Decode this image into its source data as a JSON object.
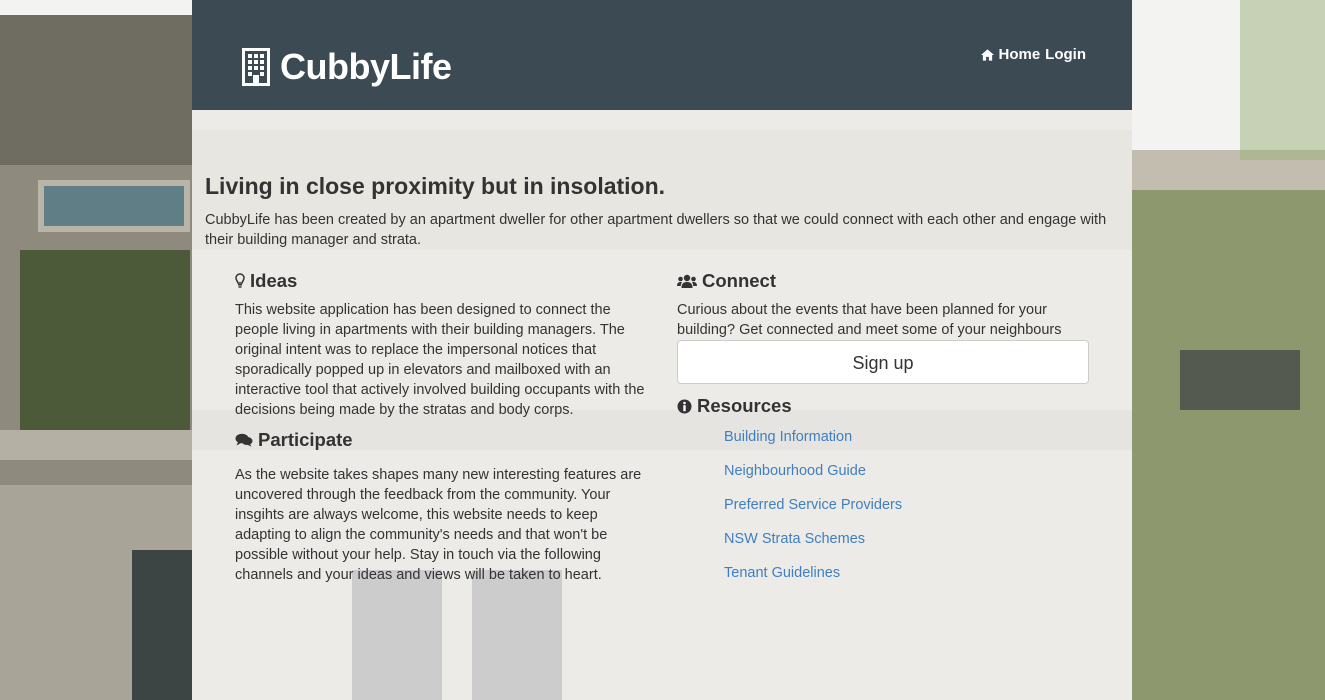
{
  "header": {
    "brand": "CubbyLife",
    "nav": {
      "home": "Home",
      "login": "Login"
    }
  },
  "main": {
    "headline": "Living in close proximity but in insolation.",
    "intro": "CubbyLife has been created by an apartment dweller for other apartment dwellers so that we could connect with each other and engage with their building manager and strata.",
    "ideas": {
      "title": "Ideas",
      "body": "This website application has been designed to connect the people living in apartments with their building managers. The original intent was to replace the impersonal notices that sporadically popped up in elevators and mailboxed with an interactive tool that actively involved building occupants with the decisions being made by the stratas and body corps."
    },
    "participate": {
      "title": "Participate",
      "body": "As the website takes shapes many new interesting features are uncovered through the feedback from the community. Your insgihts are always welcome, this website needs to keep adapting to align the community's needs and that won't be possible without your help. Stay in touch via the following channels and your ideas and views will be taken to heart."
    },
    "connect": {
      "title": "Connect",
      "body": "Curious about the events that have been planned for your building? Get connected and meet some of your neighbours",
      "signup_label": "Sign up"
    },
    "resources": {
      "title": "Resources",
      "links": [
        "Building Information",
        "Neighbourhood Guide",
        "Preferred Service Providers",
        "NSW Strata Schemes",
        "Tenant Guidelines"
      ]
    }
  },
  "icons": {
    "brand": "building-icon",
    "home": "home-icon",
    "ideas": "lightbulb-icon",
    "participate": "comments-icon",
    "connect": "users-icon",
    "resources": "info-circle-icon"
  },
  "colors": {
    "header_bg": "#3c4a53",
    "link": "#3f7fc0",
    "text": "#333333"
  }
}
